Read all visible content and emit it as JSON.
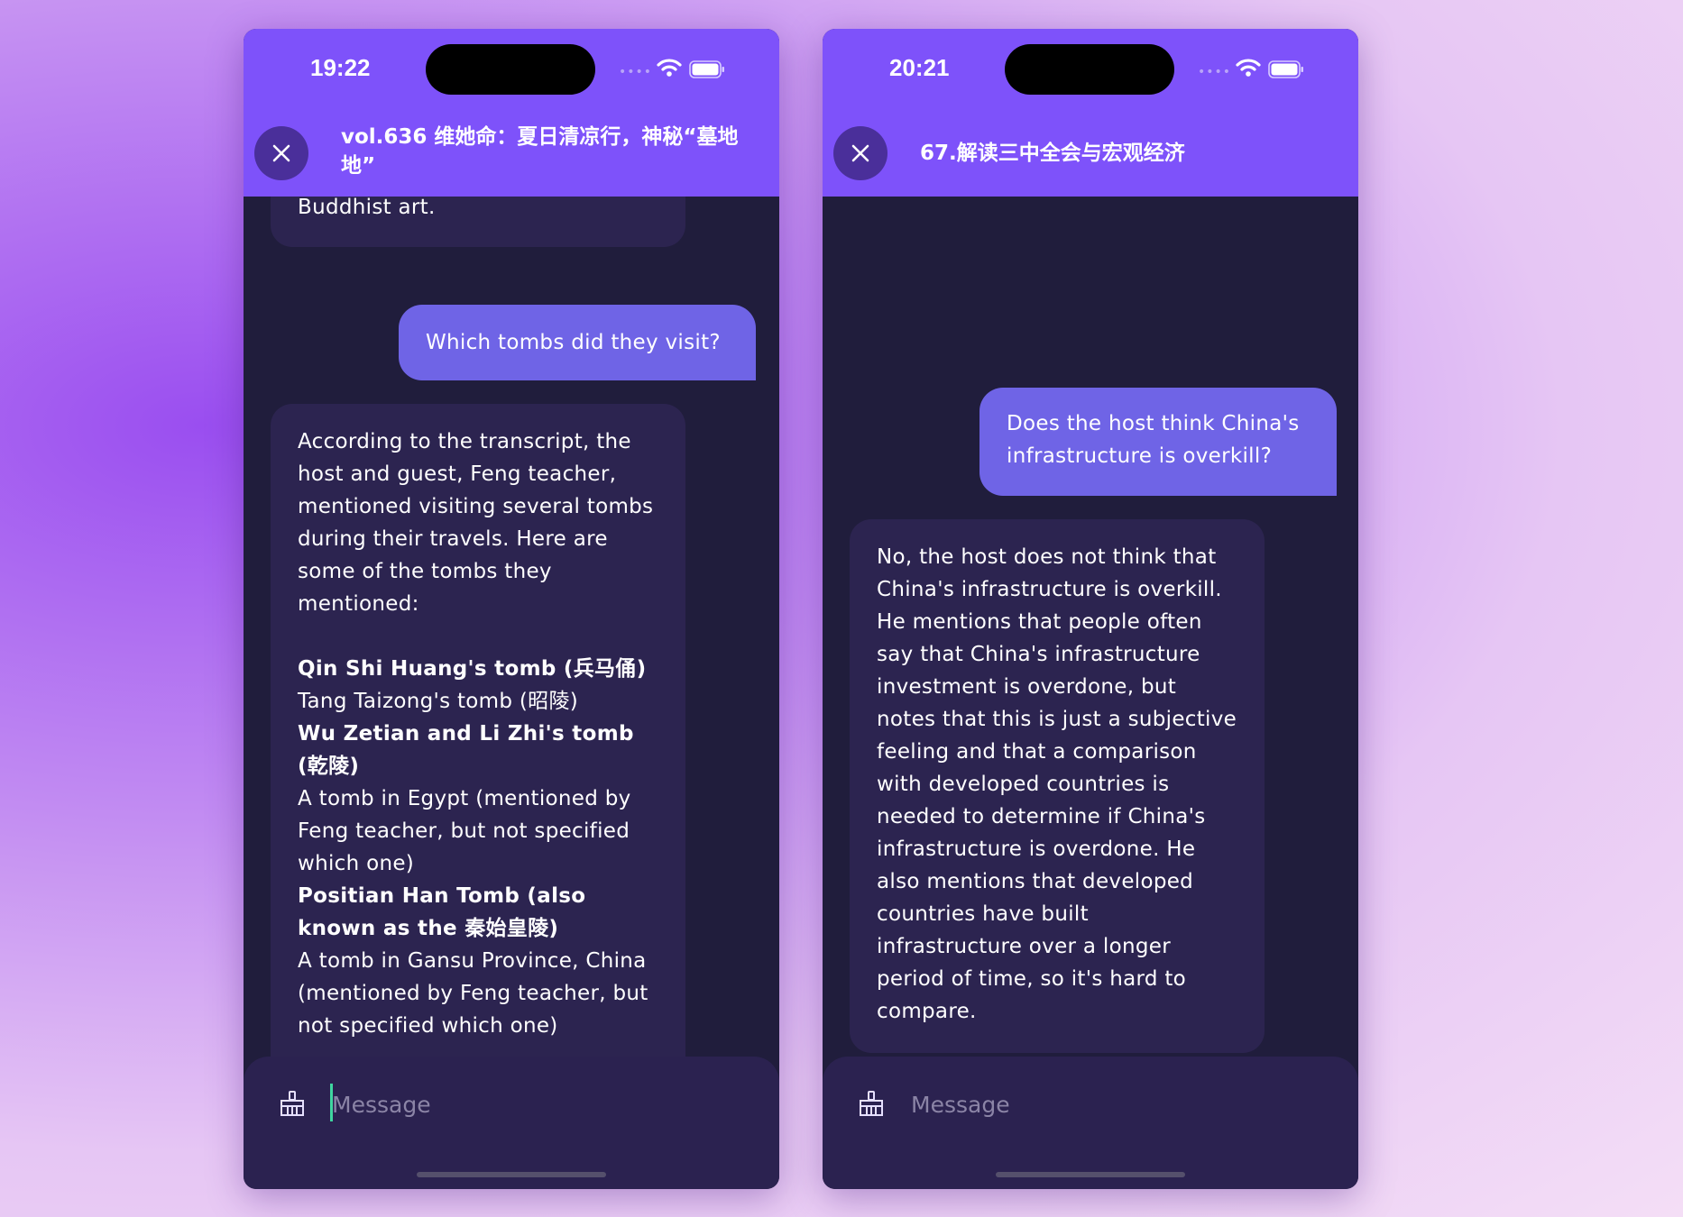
{
  "left_screen": {
    "status_time": "19:22",
    "episode_title": "vol.636 维她命：夏日清凉行，神秘“墓地地”",
    "messages": {
      "ai_partial": "Buddhist art.",
      "user_question": "Which tombs did they visit?",
      "ai_intro": "According to the transcript, the host and guest, Feng teacher, mentioned visiting several tombs during their travels. Here are some of the tombs they mentioned:",
      "tomb_1": " Qin Shi Huang's tomb (兵马俑)",
      "tomb_2": " Tang Taizong's tomb (昭陵)",
      "tomb_3": " Wu Zetian and Li Zhi's tomb (乾陵)",
      "tomb_4": " A tomb in Egypt (mentioned by Feng teacher, but not specified which one)",
      "tomb_5": " Positian Han Tomb (also known as the 秦始皇陵)",
      "tomb_6": " A tomb in Gansu Province, China (mentioned by Feng teacher, but not specified which one)"
    },
    "input_placeholder": "Message"
  },
  "right_screen": {
    "status_time": "20:21",
    "episode_title": "67.解读三中全会与宏观经济",
    "messages": {
      "user_question": "Does the host think China's infrastructure is overkill?",
      "ai_answer": "No, the host does not think that China's infrastructure is overkill. He mentions that people often say that China's infrastructure investment is overdone, but notes that this is just a subjective feeling and that a comparison with developed countries is needed to determine if China's infrastructure is overdone. He also mentions that developed countries have built infrastructure over a longer period of time, so it's hard to compare."
    },
    "input_placeholder": "Message"
  },
  "icons": {
    "close": "close-icon",
    "wifi": "wifi-icon",
    "battery": "battery-icon",
    "signal": "cellular-signal-icon",
    "clear_chat": "broom-icon"
  },
  "colors": {
    "header": "#7e52fa",
    "chat_background": "#201d3c",
    "ai_bubble": "#2c2450",
    "user_bubble": "#6f64e6",
    "input_bar": "#2b2250"
  }
}
